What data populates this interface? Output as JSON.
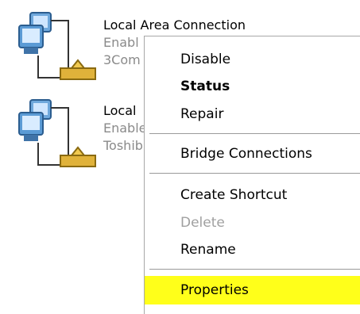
{
  "connections": [
    {
      "name": "Local Area Connection",
      "status": "Enabl",
      "device": "3Com",
      "icon": "network-connection-icon"
    },
    {
      "name": "Local",
      "status": "Enable",
      "device": "Toshib",
      "icon": "network-connection-icon"
    }
  ],
  "context_menu": {
    "items": [
      {
        "label": "Disable",
        "style": "normal"
      },
      {
        "label": "Status",
        "style": "bold"
      },
      {
        "label": "Repair",
        "style": "normal"
      },
      {
        "label": "Bridge Connections",
        "style": "normal"
      },
      {
        "label": "Create Shortcut",
        "style": "normal"
      },
      {
        "label": "Delete",
        "style": "disabled"
      },
      {
        "label": "Rename",
        "style": "normal"
      },
      {
        "label": "Properties",
        "style": "highlighted"
      }
    ],
    "highlight_color": "#ffff1a"
  }
}
